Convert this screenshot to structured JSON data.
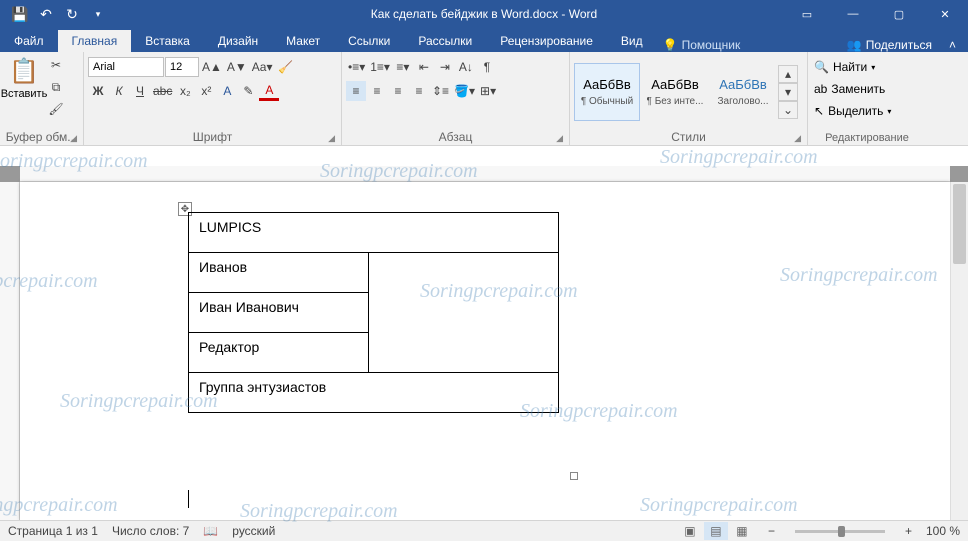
{
  "app": {
    "title": "Как сделать бейджик в Word.docx  -  Word"
  },
  "qat": {
    "save": "💾",
    "undo": "↶",
    "redo": "↻",
    "drop": "▾"
  },
  "win": {
    "opts": "▭",
    "min": "—",
    "max": "▢",
    "close": "✕"
  },
  "tabs": {
    "file": "Файл",
    "home": "Главная",
    "insert": "Вставка",
    "design": "Дизайн",
    "layout": "Макет",
    "refs": "Ссылки",
    "mail": "Рассылки",
    "review": "Рецензирование",
    "view": "Вид",
    "tellme": "Помощник",
    "share": "Поделиться"
  },
  "ribbon": {
    "clipboard": {
      "paste": "Вставить",
      "label": "Буфер обм..."
    },
    "font": {
      "name": "Arial",
      "size": "12",
      "label": "Шрифт",
      "bold": "Ж",
      "italic": "К",
      "under": "Ч",
      "strike": "abc",
      "sub": "x₂",
      "sup": "x²",
      "fx": "A",
      "hl": "✎",
      "color": "A"
    },
    "para": {
      "label": "Абзац"
    },
    "styles": {
      "label": "Стили",
      "s1": {
        "prev": "АаБбВв",
        "name": "¶ Обычный"
      },
      "s2": {
        "prev": "АаБбВв",
        "name": "¶ Без инте..."
      },
      "s3": {
        "prev": "АаБбВв",
        "name": "Заголово..."
      }
    },
    "editing": {
      "label": "Редактирование",
      "find": "Найти",
      "replace": "Заменить",
      "select": "Выделить"
    }
  },
  "doc": {
    "table": {
      "r1": "LUMPICS",
      "r2": "Иванов",
      "r3": "Иван Иванович",
      "r4": "Редактор",
      "r5": "Группа энтузиастов"
    }
  },
  "status": {
    "page": "Страница 1 из 1",
    "words": "Число слов: 7",
    "lang": "русский",
    "zoom": "100 %",
    "minus": "−",
    "plus": "+"
  },
  "watermark": "Soringpcrepair.com"
}
